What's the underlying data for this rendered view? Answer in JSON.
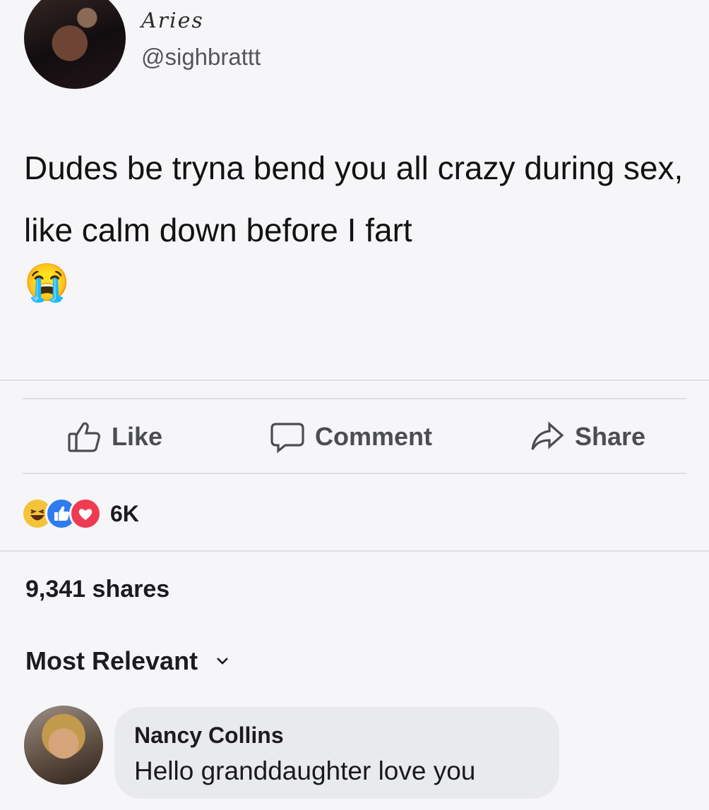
{
  "tweet": {
    "display_name": "Aries",
    "handle": "@sighbrattt",
    "text": "Dudes be tryna bend you all crazy during sex, like calm down before I fart",
    "emoji": "😭"
  },
  "actions": {
    "like_label": "Like",
    "comment_label": "Comment",
    "share_label": "Share"
  },
  "reactions": {
    "icons": [
      "haha-icon",
      "like-icon",
      "love-icon"
    ],
    "count": "6K"
  },
  "shares_text": "9,341 shares",
  "sort": {
    "label": "Most Relevant"
  },
  "comment": {
    "author": "Nancy Collins",
    "text": "Hello granddaughter love you"
  },
  "colors": {
    "background": "#f6f6f8",
    "bubble": "#e9eaee",
    "like_blue": "#2f7bf0",
    "love_red": "#ee3b52",
    "haha_yellow": "#f5c33b"
  }
}
